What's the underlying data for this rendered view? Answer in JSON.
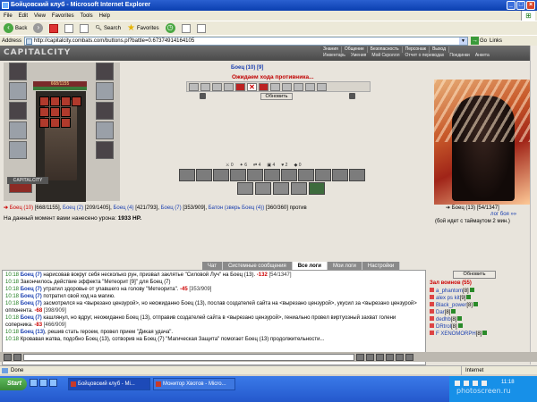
{
  "window": {
    "title": "Бойцовский клуб - Microsoft Internet Explorer"
  },
  "menu": [
    "File",
    "Edit",
    "View",
    "Favorites",
    "Tools",
    "Help"
  ],
  "toolbar": {
    "back": "Back",
    "search": "Search",
    "favorites": "Favorites"
  },
  "address": {
    "label": "Address",
    "url": "http://capitalcity.combats.com/buttons.pl?battle=0.67374914164105",
    "go": "Go",
    "links": "Links"
  },
  "site": {
    "logo": "CAPITALCITY",
    "nav_top": [
      "Знания",
      "Общение",
      "Безопасность",
      "Персонаж",
      "Выход"
    ],
    "nav_bottom": [
      "Инвентарь",
      "Умения",
      "Мой Скроллл",
      "Отчет о переводах",
      "Поединки",
      "Анкета"
    ]
  },
  "player": {
    "hp": "668/1155",
    "panel_label": "CAPITALCITY"
  },
  "battle": {
    "opponent_header": "Боец (10) [9]",
    "waiting": "Ожидаем хода противника...",
    "refresh": "Обновить",
    "stats": [
      "0",
      "6",
      "4",
      "4",
      "2",
      "0"
    ],
    "fight_left": [
      {
        "name": "Боец (10)",
        "hp": "[668/1155]"
      },
      {
        "name": "Боец (2)",
        "hp": "[209/1405]"
      },
      {
        "name": "Боец (4)",
        "hp": "[421/793]"
      },
      {
        "name": "Боец (7)",
        "hp": "[353/909]"
      },
      {
        "name": "Батон (зверь Боец (4))",
        "hp": "[360/360]"
      }
    ],
    "versus": "против",
    "fight_right": {
      "name": "Боец (13)",
      "hp": "[54/1347]"
    },
    "battle_log_link": "лог боя »»",
    "timeout_note": "(бой идет с таймаутом 2 мин.)",
    "damage_label": "На данный момент вами нанесено урона:",
    "damage_value": "1933 HP."
  },
  "tabs": [
    "Чат",
    "Системные сообщения",
    "Все логи",
    "Мои логи",
    "Настройки"
  ],
  "active_tab": "Все логи",
  "log": [
    {
      "time": "10:18",
      "who": "Боец (7)",
      "text": " нарисовав вокруг себя несколько рун, призвал заклятье \"Силовой Луч\" на Боец (13). ",
      "dmg": "-132",
      "hp": " [54/1347]"
    },
    {
      "time": "10:18",
      "who": "",
      "text": "Закончилось действие эффекта \"Метеорит [9]\" для Боец (7)",
      "dmg": "",
      "hp": ""
    },
    {
      "time": "10:18",
      "who": "Боец (7)",
      "text": " утратил здоровье от упавшего на голову \"Метеорита\". ",
      "dmg": "-45",
      "hp": " [353/909]"
    },
    {
      "time": "10:18",
      "who": "Боец (7)",
      "text": " потратил свой ход на магию.",
      "dmg": "",
      "hp": ""
    },
    {
      "time": "10:18",
      "who": "Боец (7)",
      "text": " засмотрелся на <вырезано цензурой>, но неожиданно Боец (13), послав создателей сайта на <вырезано цензурой>, укусил за <вырезано цензурой> оппонента. ",
      "dmg": "-68",
      "hp": " [398/909]"
    },
    {
      "time": "10:18",
      "who": "Боец (7)",
      "text": " кашлянул, но вдруг, неожиданно Боец (13), отправив создателей сайта в <вырезано цензурой>, гениально провел виртуозный захват голени соперника. ",
      "dmg": "-83",
      "hp": " [466/909]"
    },
    {
      "time": "10:18",
      "who": "Боец (13)",
      "text": ", решив стать героем, провел прием \"Дикая удача\".",
      "dmg": "",
      "hp": ""
    },
    {
      "time": "10:18",
      "who": "",
      "text": "Кровавая жатва, подобно Боец (13), сотворив на Боец (7) \"Магическая Защита\" помогает Боец (13) продолжительности...",
      "dmg": "",
      "hp": ""
    }
  ],
  "side": {
    "refresh": "Обновить",
    "warriors_title": "Зал воинов (55)",
    "players": [
      {
        "name": "a_phantom",
        "lvl": "[8]"
      },
      {
        "name": "alex ps kit",
        "lvl": "[9]"
      },
      {
        "name": "Black_power",
        "lvl": "[8]"
      },
      {
        "name": "Dar",
        "lvl": "[8]"
      },
      {
        "name": "dedhb",
        "lvl": "[8]"
      },
      {
        "name": "DRtrol",
        "lvl": "[8]"
      },
      {
        "name": "F XENOMORPH",
        "lvl": "[8]"
      }
    ]
  },
  "status": {
    "done": "Done",
    "zone": "Internet"
  },
  "taskbar": {
    "start": "Start",
    "tasks": [
      "Бойцовский клуб - Mi...",
      "Монитор Хвотов - Micro..."
    ],
    "clock": "11:18",
    "watermark": "photoscreen.ru"
  }
}
